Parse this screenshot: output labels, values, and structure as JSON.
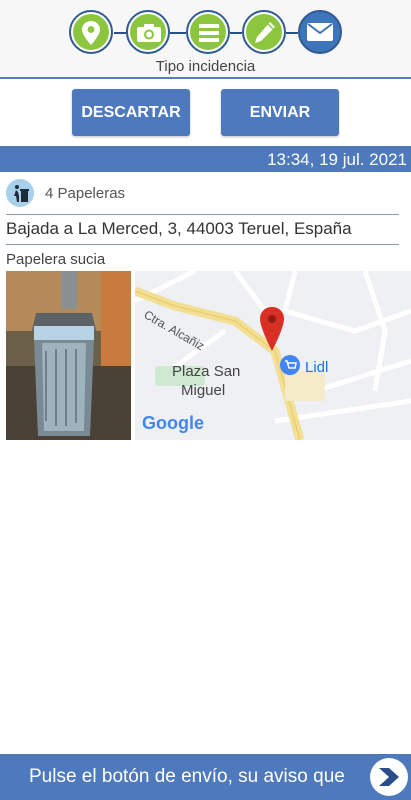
{
  "stepper": {
    "label": "Tipo incidencia",
    "steps": [
      {
        "icon": "location-pin-icon",
        "state": "done"
      },
      {
        "icon": "camera-icon",
        "state": "done"
      },
      {
        "icon": "list-icon",
        "state": "done"
      },
      {
        "icon": "pencil-icon",
        "state": "done"
      },
      {
        "icon": "envelope-icon",
        "state": "active"
      }
    ]
  },
  "actions": {
    "discard_label": "DESCARTAR",
    "send_label": "ENVIAR"
  },
  "report": {
    "datetime": "13:34, 19 jul. 2021",
    "count_label": "4 Papeleras",
    "address": "Bajada a La Merced, 3, 44003 Teruel, España",
    "incident_type": "Papelera sucia"
  },
  "map": {
    "street_label": "Ctra. Alcañiz",
    "place_label_line1": "Plaza San",
    "place_label_line2": "Miguel",
    "poi_label": "Lidl",
    "provider_label": "Google"
  },
  "footer": {
    "message": "Pulse el botón de envío, su aviso que"
  },
  "colors": {
    "primary": "#4f79bd",
    "done_green": "#8cc63f",
    "active_blue": "#3e74b9"
  }
}
